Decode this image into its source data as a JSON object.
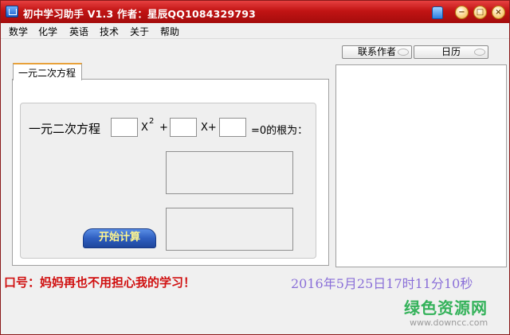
{
  "window": {
    "title": "初中学习助手  V1.3   作者：星辰QQ1084329793",
    "controls": {
      "minimize_icon": "minimize-icon",
      "maximize_icon": "maximize-icon",
      "close_icon": "close-icon",
      "skin_icon": "shirt-icon"
    }
  },
  "menu": {
    "items": [
      {
        "label": "数学"
      },
      {
        "label": "化学"
      },
      {
        "label": "英语"
      },
      {
        "label": "技术"
      },
      {
        "label": "关于"
      },
      {
        "label": "帮助"
      }
    ]
  },
  "tabs": [
    {
      "label": "一元二次方程",
      "active": true
    }
  ],
  "equation": {
    "label": "一元二次方程",
    "x_squared": "X",
    "superscript": "2",
    "plus": "+",
    "x_plus": "X+",
    "suffix": "=0的根为：",
    "a_value": "",
    "b_value": "",
    "c_value": ""
  },
  "results": {
    "root1": "",
    "root2": ""
  },
  "buttons": {
    "calculate": "开始计算",
    "contact": "联系作者",
    "calendar": "日历"
  },
  "footer": {
    "slogan": "口号：妈妈再也不用担心我的学习！",
    "clock": "2016年5月25日17时11分10秒"
  },
  "watermark": {
    "title": "绿色资源网",
    "url": "www.downcc.com"
  },
  "colors": {
    "titlebar": "#c21414",
    "slogan": "#d01010",
    "clock": "#8a6fd8",
    "calc_button": "#2f5fc0",
    "watermark": "#34b25a"
  }
}
